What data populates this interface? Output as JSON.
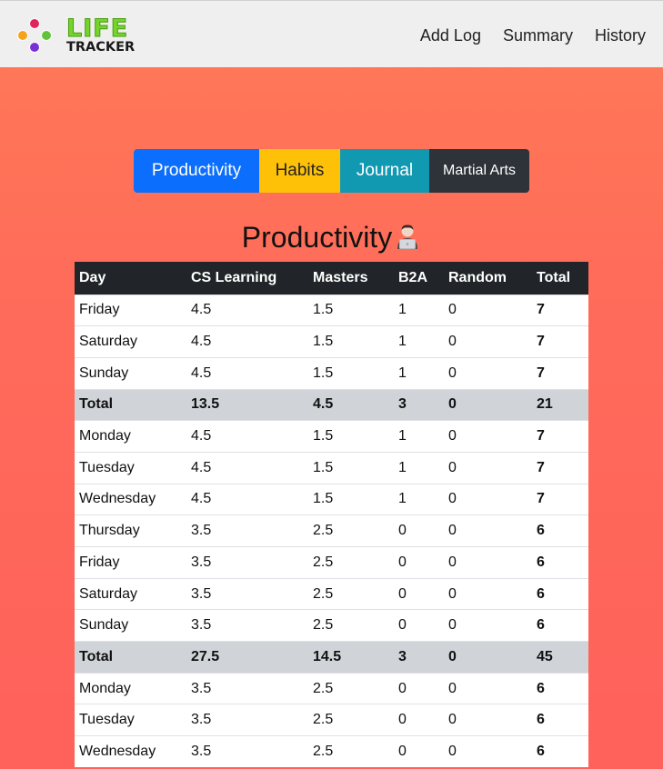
{
  "navbar": {
    "logo_line1": "LIFE",
    "logo_line2": "TRACKER",
    "links": [
      "Add Log",
      "Summary",
      "History"
    ]
  },
  "tabs": [
    {
      "label": "Productivity",
      "color": "#0b6efd"
    },
    {
      "label": "Habits",
      "color": "#ffc107"
    },
    {
      "label": "Journal",
      "color": "#1199b2"
    },
    {
      "label": "Martial Arts",
      "color": "#2d3338"
    }
  ],
  "heading": "Productivity",
  "table": {
    "headers": [
      "Day",
      "CS Learning",
      "Masters",
      "B2A",
      "Random",
      "Total"
    ],
    "rows": [
      {
        "cells": [
          "Friday",
          "4.5",
          "1.5",
          "1",
          "0",
          "7"
        ],
        "total": false
      },
      {
        "cells": [
          "Saturday",
          "4.5",
          "1.5",
          "1",
          "0",
          "7"
        ],
        "total": false
      },
      {
        "cells": [
          "Sunday",
          "4.5",
          "1.5",
          "1",
          "0",
          "7"
        ],
        "total": false
      },
      {
        "cells": [
          "Total",
          "13.5",
          "4.5",
          "3",
          "0",
          "21"
        ],
        "total": true
      },
      {
        "cells": [
          "Monday",
          "4.5",
          "1.5",
          "1",
          "0",
          "7"
        ],
        "total": false
      },
      {
        "cells": [
          "Tuesday",
          "4.5",
          "1.5",
          "1",
          "0",
          "7"
        ],
        "total": false
      },
      {
        "cells": [
          "Wednesday",
          "4.5",
          "1.5",
          "1",
          "0",
          "7"
        ],
        "total": false
      },
      {
        "cells": [
          "Thursday",
          "3.5",
          "2.5",
          "0",
          "0",
          "6"
        ],
        "total": false
      },
      {
        "cells": [
          "Friday",
          "3.5",
          "2.5",
          "0",
          "0",
          "6"
        ],
        "total": false
      },
      {
        "cells": [
          "Saturday",
          "3.5",
          "2.5",
          "0",
          "0",
          "6"
        ],
        "total": false
      },
      {
        "cells": [
          "Sunday",
          "3.5",
          "2.5",
          "0",
          "0",
          "6"
        ],
        "total": false
      },
      {
        "cells": [
          "Total",
          "27.5",
          "14.5",
          "3",
          "0",
          "45"
        ],
        "total": true
      },
      {
        "cells": [
          "Monday",
          "3.5",
          "2.5",
          "0",
          "0",
          "6"
        ],
        "total": false
      },
      {
        "cells": [
          "Tuesday",
          "3.5",
          "2.5",
          "0",
          "0",
          "6"
        ],
        "total": false
      },
      {
        "cells": [
          "Wednesday",
          "3.5",
          "2.5",
          "0",
          "0",
          "6"
        ],
        "total": false
      }
    ]
  }
}
